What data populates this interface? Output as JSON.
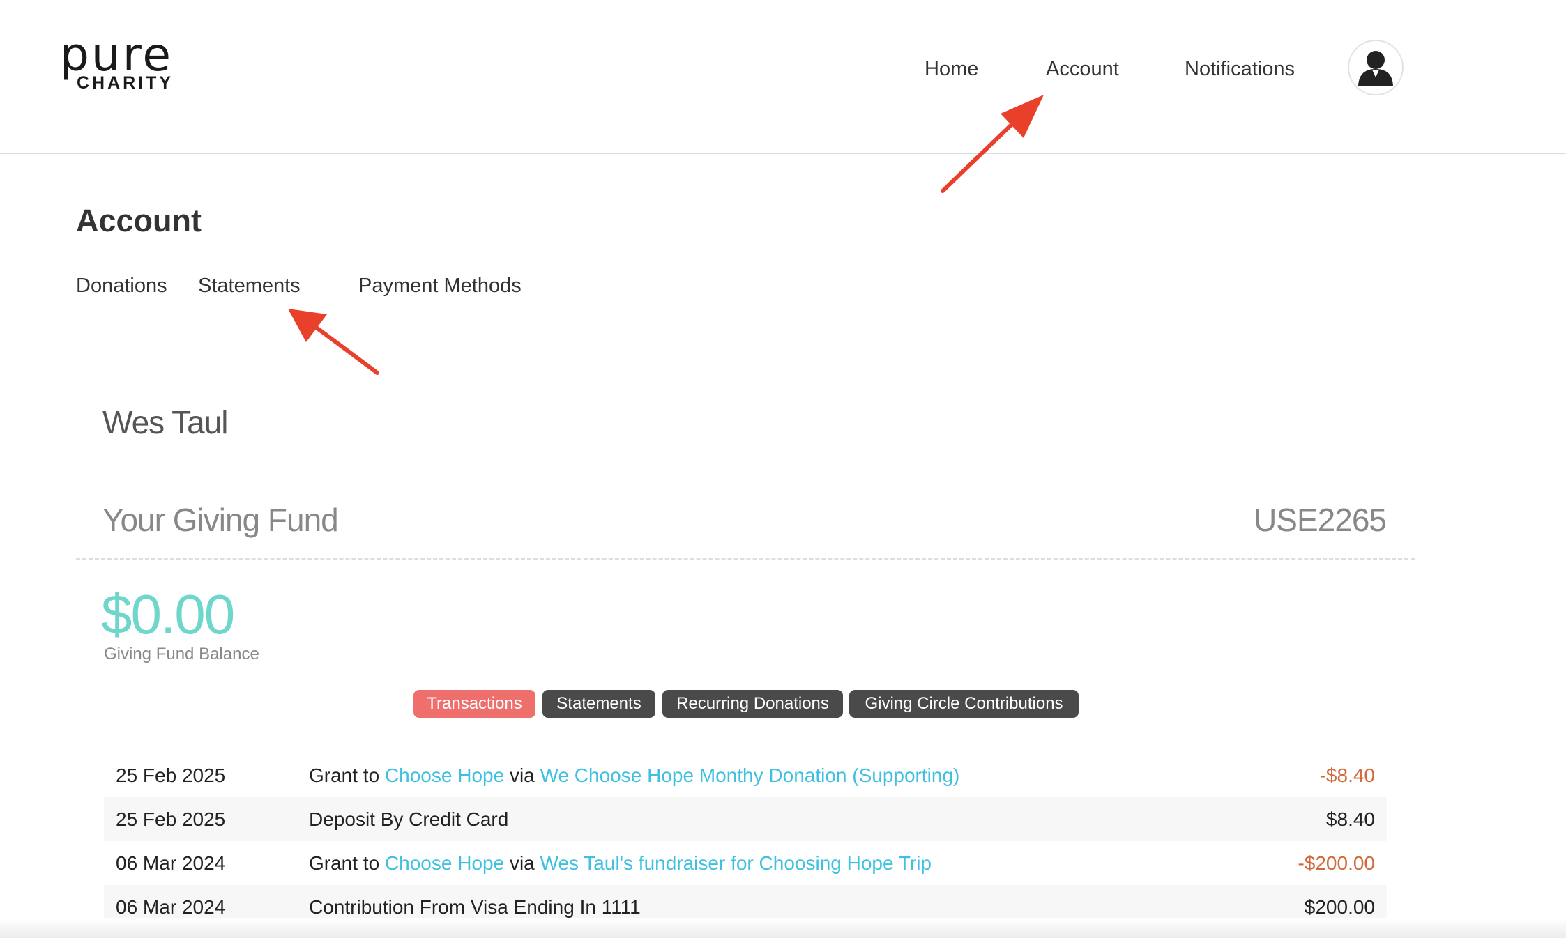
{
  "header": {
    "logo_line1": "pure",
    "logo_line2": "CHARITY",
    "nav": [
      "Home",
      "Account",
      "Notifications"
    ]
  },
  "page": {
    "title": "Account",
    "subnav": [
      "Donations",
      "Statements",
      "Payment Methods"
    ]
  },
  "profile": {
    "name": "Wes Taul"
  },
  "fund": {
    "label": "Your Giving Fund",
    "id": "USE2265",
    "balance": "$0.00",
    "balance_label": "Giving Fund Balance"
  },
  "tabs": [
    "Transactions",
    "Statements",
    "Recurring Donations",
    "Giving Circle Contributions"
  ],
  "active_tab": "Transactions",
  "transactions": [
    {
      "date": "25 Feb 2025",
      "prefix": "Grant to ",
      "link1": "Choose Hope",
      "mid": " via ",
      "link2": "We Choose Hope Monthy Donation (Supporting)",
      "amount": "-$8.40"
    },
    {
      "date": "25 Feb 2025",
      "text": "Deposit By Credit Card",
      "amount": "$8.40"
    },
    {
      "date": "06 Mar 2024",
      "prefix": "Grant to ",
      "link1": "Choose Hope",
      "mid": " via ",
      "link2": "Wes Taul's fundraiser for Choosing Hope Trip",
      "amount": "-$200.00"
    },
    {
      "date": "06 Mar 2024",
      "text": "Contribution From Visa Ending In 1111",
      "amount": "$200.00"
    }
  ],
  "colors": {
    "accent_teal": "#6fd6cc",
    "link_blue": "#3fc0e0",
    "negative": "#d2693a",
    "active_tab": "#ef6f6c",
    "tab": "#4a4a4a",
    "annotation_arrow": "#e8402a"
  },
  "icons": [
    "user-avatar-icon",
    "annotation-arrow"
  ]
}
